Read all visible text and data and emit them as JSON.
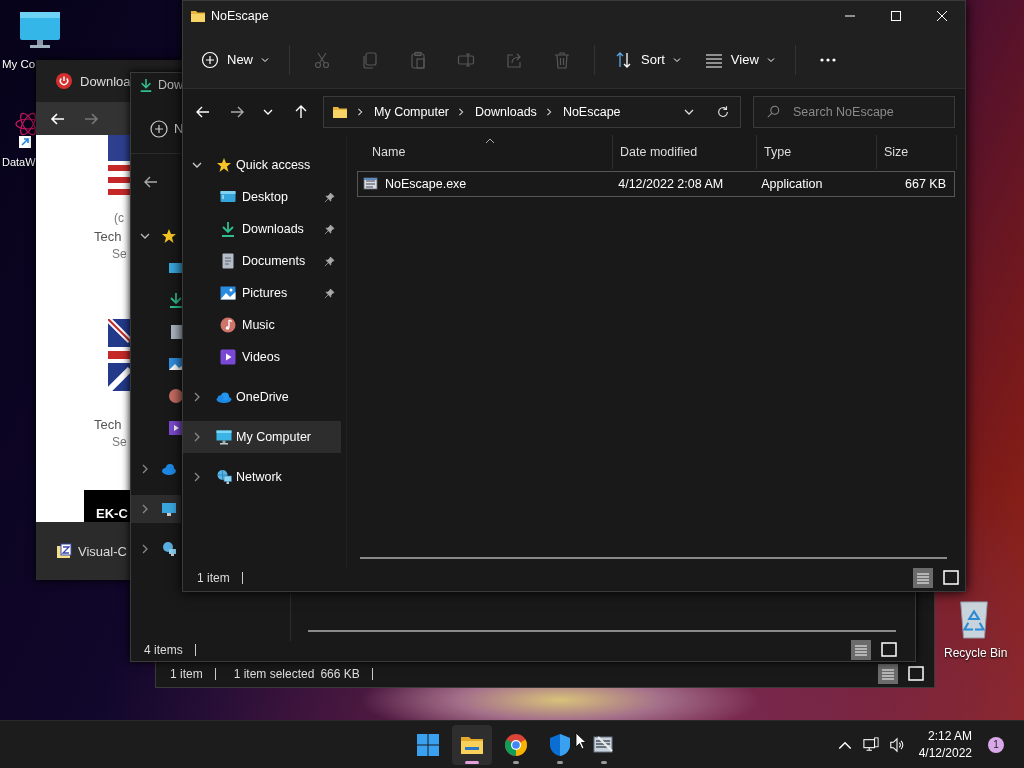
{
  "desktop": {
    "icons": [
      {
        "label": "My Co"
      },
      {
        "label": "DataW"
      },
      {
        "label": "Recycle Bin"
      }
    ]
  },
  "browser_window": {
    "tab_title": "Downloa",
    "page_texts": [
      "(c",
      "Tech",
      "Se",
      "Tech",
      "Se"
    ],
    "banner_text": "EK-C",
    "download_item": "Visual-C"
  },
  "explorer_window_2": {
    "tab_title": "Dow",
    "new_button": "N",
    "status": "4 items"
  },
  "explorer_window_3": {
    "status": [
      "1 item",
      "1 item selected",
      "666 KB"
    ]
  },
  "window": {
    "title": "NoEscape",
    "toolbar": [
      {
        "kind": "new",
        "label": "New",
        "disabled": false
      },
      {
        "kind": "cut",
        "disabled": true
      },
      {
        "kind": "copy",
        "disabled": true
      },
      {
        "kind": "paste",
        "disabled": true
      },
      {
        "kind": "rename",
        "disabled": true
      },
      {
        "kind": "share",
        "disabled": true
      },
      {
        "kind": "delete",
        "disabled": true
      },
      {
        "kind": "sort",
        "label": "Sort",
        "disabled": false
      },
      {
        "kind": "view",
        "label": "View",
        "disabled": false
      },
      {
        "kind": "more",
        "disabled": false
      }
    ],
    "breadcrumbs": [
      "My Computer",
      "Downloads",
      "NoEscape"
    ],
    "search": {
      "placeholder": "Search NoEscape"
    },
    "sidebar": [
      {
        "kind": "quick",
        "label": "Quick access",
        "expanded": true,
        "selected": false,
        "children": [
          {
            "kind": "desktop",
            "label": "Desktop",
            "pinned": true,
            "selected": false
          },
          {
            "kind": "downloads",
            "label": "Downloads",
            "pinned": true,
            "selected": false
          },
          {
            "kind": "documents",
            "label": "Documents",
            "pinned": true,
            "selected": false
          },
          {
            "kind": "pictures",
            "label": "Pictures",
            "pinned": true,
            "selected": false
          },
          {
            "kind": "music",
            "label": "Music",
            "pinned": false,
            "selected": false
          },
          {
            "kind": "videos",
            "label": "Videos",
            "pinned": false,
            "selected": false
          }
        ]
      },
      {
        "kind": "onedrive",
        "label": "OneDrive",
        "expanded": false,
        "selected": false
      },
      {
        "kind": "computer",
        "label": "My Computer",
        "expanded": false,
        "selected": true
      },
      {
        "kind": "network",
        "label": "Network",
        "expanded": false,
        "selected": false
      }
    ],
    "columns": [
      {
        "label": "Name",
        "sorted": true
      },
      {
        "label": "Date modified",
        "sorted": false
      },
      {
        "label": "Type",
        "sorted": false
      },
      {
        "label": "Size",
        "sorted": false
      }
    ],
    "rows": [
      {
        "name": "NoEscape.exe",
        "date_modified": "4/12/2022 2:08 AM",
        "type": "Application",
        "size": "667 KB",
        "focused": true
      }
    ],
    "status": "1 item",
    "view_buttons": [
      {
        "kind": "details",
        "selected": true
      },
      {
        "kind": "tiles",
        "selected": false
      }
    ]
  },
  "taskbar": {
    "apps": [
      {
        "kind": "start",
        "active": false
      },
      {
        "kind": "explorer",
        "active": true
      },
      {
        "kind": "chrome",
        "active": false
      },
      {
        "kind": "defender",
        "active": false
      },
      {
        "kind": "app",
        "active": false
      }
    ],
    "time": "2:12 AM",
    "date": "4/12/2022",
    "notifications": "1"
  }
}
